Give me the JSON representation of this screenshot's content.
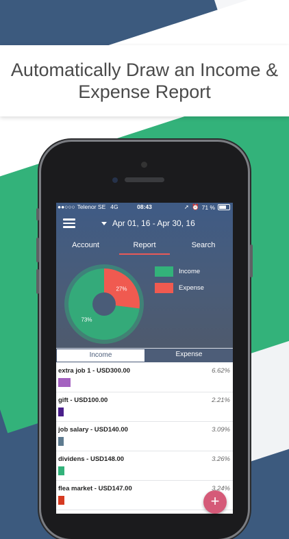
{
  "headline": "Automatically Draw an Income & Expense Report",
  "colors": {
    "income": "#33b27a",
    "expense": "#f05a50",
    "accent": "#ea5a57",
    "fab": "#d55a78"
  },
  "status_bar": {
    "signal": "●●○○○",
    "carrier": "Telenor SE",
    "network": "4G",
    "time": "08:43",
    "battery_pct": "71 %",
    "icons": [
      "location-icon",
      "alarm-icon",
      "battery-icon"
    ]
  },
  "header": {
    "menu_icon": "hamburger-icon",
    "date_range": "Apr 01, 16 - Apr 30, 16"
  },
  "tabs": [
    {
      "label": "Account",
      "active": false
    },
    {
      "label": "Report",
      "active": true
    },
    {
      "label": "Search",
      "active": false
    }
  ],
  "chart_data": {
    "type": "pie",
    "slices": [
      {
        "name": "Income",
        "value": 73,
        "label": "73%"
      },
      {
        "name": "Expense",
        "value": 27,
        "label": "27%"
      }
    ],
    "legend": [
      "Income",
      "Expense"
    ],
    "legend_position": "right"
  },
  "segment": {
    "income_label": "Income",
    "expense_label": "Expense",
    "selected": "Income"
  },
  "items": [
    {
      "title": "extra job 1 - USD300.00",
      "pct": "6.62%",
      "value": 6.62,
      "color": "#a462c0"
    },
    {
      "title": "gift - USD100.00",
      "pct": "2.21%",
      "value": 2.21,
      "color": "#4a1f8a"
    },
    {
      "title": "job salary - USD140.00",
      "pct": "3.09%",
      "value": 3.09,
      "color": "#5e7b8f"
    },
    {
      "title": "dividens - USD148.00",
      "pct": "3.26%",
      "value": 3.26,
      "color": "#33b27a"
    },
    {
      "title": "flea market - USD147.00",
      "pct": "3.24%",
      "value": 3.24,
      "color": "#d63b22"
    }
  ],
  "fab_label": "+"
}
